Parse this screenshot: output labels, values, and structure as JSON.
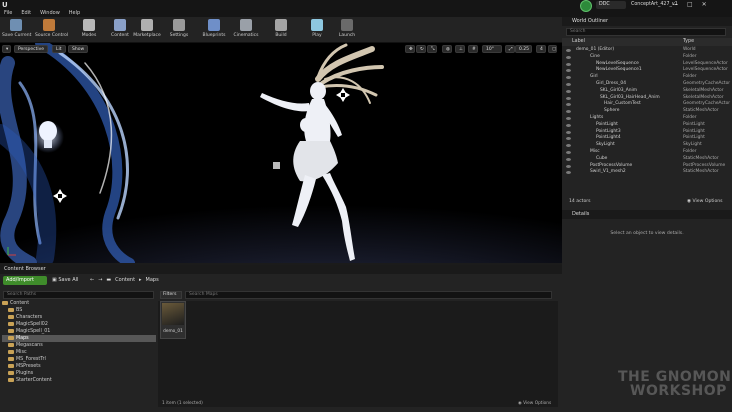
{
  "app": {
    "menu": [
      "File",
      "Edit",
      "Window",
      "Help"
    ],
    "project_tabs": [
      "DDC",
      "ConceptArt_427_v1"
    ],
    "window_controls": [
      "—",
      "□",
      "✕"
    ]
  },
  "toolbar": {
    "buttons": [
      {
        "label": "Save Current",
        "color": "#6f8fb2"
      },
      {
        "label": "Source Control",
        "color": "#bf7a3a"
      },
      {
        "label": "Modes",
        "color": "#b8b8b8"
      },
      {
        "label": "Content",
        "color": "#8aa0c8"
      },
      {
        "label": "Marketplace",
        "color": "#b0b0b0"
      },
      {
        "label": "Settings",
        "color": "#9a9a9a"
      },
      {
        "label": "Blueprints",
        "color": "#6f8fc8"
      },
      {
        "label": "Cinematics",
        "color": "#9aa0a8"
      },
      {
        "label": "Build",
        "color": "#a4a4a4"
      },
      {
        "label": "Play",
        "color": "#8ec8e0"
      },
      {
        "label": "Launch",
        "color": "#6a6a6a"
      }
    ]
  },
  "viewport": {
    "perspective": "Perspective",
    "lit": "Lit",
    "show": "Show",
    "angle": "10°",
    "speed": "0.25",
    "scale": "4"
  },
  "content_browser": {
    "tab": "Content Browser",
    "add_import": "Add/Import",
    "save_all": "Save All",
    "breadcrumb": [
      "Content",
      "Maps"
    ],
    "search_paths_placeholder": "Search Paths",
    "filters_label": "Filters",
    "search_maps_placeholder": "Search Maps",
    "folders": [
      "Content",
      "BS",
      "Characters",
      "MagicSpell02",
      "MagicSpell_01",
      "Maps",
      "Megascans",
      "Misc",
      "MS_ForestTrl",
      "MSPresets",
      "Plugins",
      "StarterContent"
    ],
    "asset_name": "demo_01",
    "item_count": "1 item (1 selected)",
    "view_options": "View Options"
  },
  "outliner": {
    "tab": "World Outliner",
    "search_placeholder": "Search",
    "col_label": "Label",
    "col_type": "Type",
    "rows": [
      {
        "label": "demo_01 (Editor)",
        "type": "World"
      },
      {
        "label": "Cine",
        "type": "Folder"
      },
      {
        "label": "NewLevelSequence",
        "type": "LevelSequenceActor"
      },
      {
        "label": "NewLevelSequence1",
        "type": "LevelSequenceActor"
      },
      {
        "label": "Girl",
        "type": "Folder"
      },
      {
        "label": "Girl_Dress_04",
        "type": "GeometryCacheActor"
      },
      {
        "label": "SKL_Girl03_Anim",
        "type": "SkeletalMeshActor"
      },
      {
        "label": "SKL_Girl03_HairHead_Anim",
        "type": "SkeletalMeshActor"
      },
      {
        "label": "Hair_CustomTest",
        "type": "GeometryCacheActor"
      },
      {
        "label": "Sphere",
        "type": "StaticMeshActor"
      },
      {
        "label": "Lights",
        "type": "Folder"
      },
      {
        "label": "PointLight",
        "type": "PointLight"
      },
      {
        "label": "PointLight3",
        "type": "PointLight"
      },
      {
        "label": "PointLight4",
        "type": "PointLight"
      },
      {
        "label": "SkyLight",
        "type": "SkyLight"
      },
      {
        "label": "Misc",
        "type": "Folder"
      },
      {
        "label": "Cube",
        "type": "StaticMeshActor"
      },
      {
        "label": "PostProcessVolume",
        "type": "PostProcessVolume"
      },
      {
        "label": "Swirl_V1_mesh2",
        "type": "StaticMeshActor"
      }
    ],
    "actor_count": "14 actors",
    "view_options": "View Options"
  },
  "details": {
    "tab": "Details",
    "message": "Select an object to view details."
  },
  "watermark": {
    "line1": "THE GNOMON",
    "line2": "WORKSHOP"
  }
}
